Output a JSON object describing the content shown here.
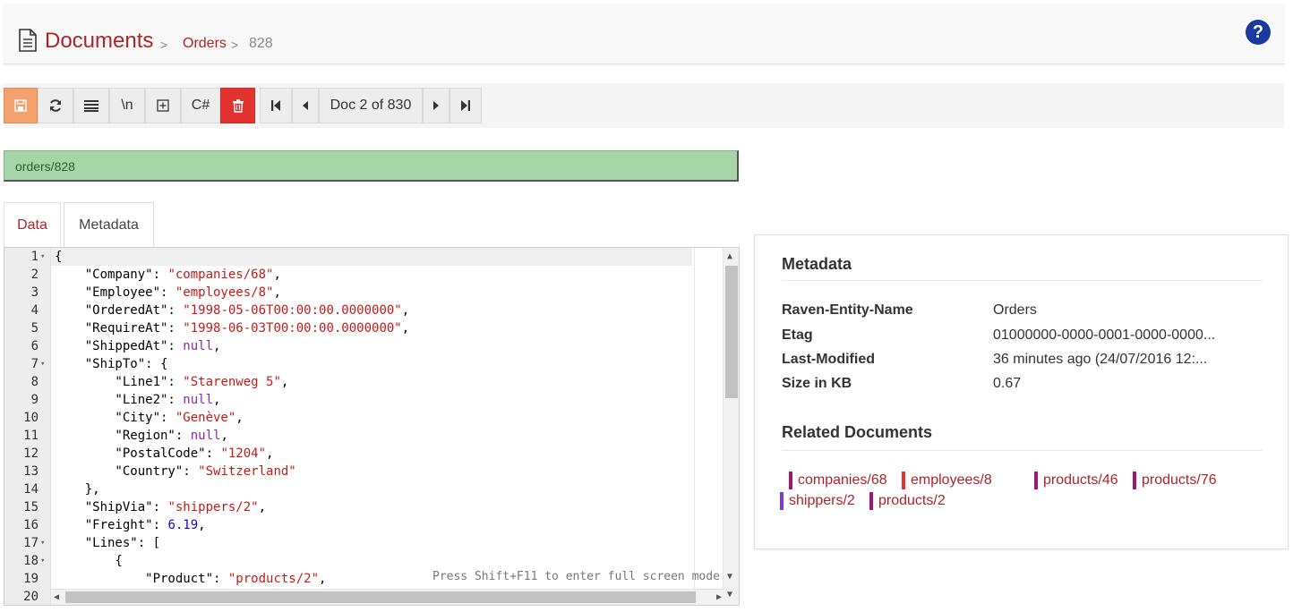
{
  "header": {
    "title": "Documents",
    "breadcrumb_sep": ">",
    "collection": "Orders",
    "doc_number": "828",
    "help": "?"
  },
  "toolbar": {
    "save_icon": "save-icon",
    "reload_icon": "refresh-icon",
    "format_icon": "format-icon",
    "newline_label": "\\n",
    "expand_icon": "expand-icon",
    "csharp_label": "C#",
    "delete_icon": "trash-icon",
    "doc_nav": "Doc 2 of 830"
  },
  "document": {
    "id": "orders/828"
  },
  "tabs": {
    "data": "Data",
    "metadata": "Metadata"
  },
  "editor": {
    "lines": [
      {
        "num": "1",
        "fold": true,
        "code": "{"
      },
      {
        "num": "2",
        "fold": false,
        "code": "    \"Company\": \"companies/68\","
      },
      {
        "num": "3",
        "fold": false,
        "code": "    \"Employee\": \"employees/8\","
      },
      {
        "num": "4",
        "fold": false,
        "code": "    \"OrderedAt\": \"1998-05-06T00:00:00.0000000\","
      },
      {
        "num": "5",
        "fold": false,
        "code": "    \"RequireAt\": \"1998-06-03T00:00:00.0000000\","
      },
      {
        "num": "6",
        "fold": false,
        "code": "    \"ShippedAt\": null,"
      },
      {
        "num": "7",
        "fold": true,
        "code": "    \"ShipTo\": {"
      },
      {
        "num": "8",
        "fold": false,
        "code": "        \"Line1\": \"Starenweg 5\","
      },
      {
        "num": "9",
        "fold": false,
        "code": "        \"Line2\": null,"
      },
      {
        "num": "10",
        "fold": false,
        "code": "        \"City\": \"Genève\","
      },
      {
        "num": "11",
        "fold": false,
        "code": "        \"Region\": null,"
      },
      {
        "num": "12",
        "fold": false,
        "code": "        \"PostalCode\": \"1204\","
      },
      {
        "num": "13",
        "fold": false,
        "code": "        \"Country\": \"Switzerland\""
      },
      {
        "num": "14",
        "fold": false,
        "code": "    },"
      },
      {
        "num": "15",
        "fold": false,
        "code": "    \"ShipVia\": \"shippers/2\","
      },
      {
        "num": "16",
        "fold": false,
        "code": "    \"Freight\": 6.19,"
      },
      {
        "num": "17",
        "fold": true,
        "code": "    \"Lines\": ["
      },
      {
        "num": "18",
        "fold": true,
        "code": "        {"
      },
      {
        "num": "19",
        "fold": false,
        "code": "            \"Product\": \"products/2\","
      },
      {
        "num": "20",
        "fold": false,
        "code": ""
      }
    ],
    "hint": "Press Shift+F11 to enter full screen mode"
  },
  "metadata_panel": {
    "title": "Metadata",
    "rows": [
      {
        "key": "Raven-Entity-Name",
        "value": "Orders"
      },
      {
        "key": "Etag",
        "value": "01000000-0000-0001-0000-0000..."
      },
      {
        "key": "Last-Modified",
        "value": "36 minutes ago (24/07/2016 12:..."
      },
      {
        "key": "Size in KB",
        "value": "0.67"
      }
    ],
    "related_title": "Related Documents",
    "related": [
      {
        "label": "companies/68",
        "color": "#a0157a"
      },
      {
        "label": "employees/8",
        "color": "#e0322f"
      },
      {
        "label": "products/46",
        "color": "#a0157a"
      },
      {
        "label": "products/76",
        "color": "#a0157a"
      },
      {
        "label": "shippers/2",
        "color": "#7b3fc9"
      },
      {
        "label": "products/2",
        "color": "#a0157a"
      }
    ]
  },
  "colors": {
    "accent": "#a8252a",
    "save": "#f3a26d",
    "delete": "#e0322f",
    "docid_bg": "#a8d5a8",
    "help": "#1a3a9e"
  }
}
